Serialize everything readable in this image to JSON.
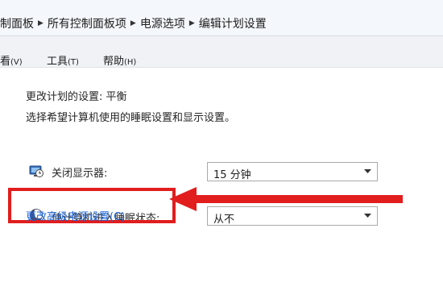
{
  "breadcrumb": {
    "items": [
      "制面板",
      "所有控制面板项",
      "电源选项",
      "编辑计划设置"
    ]
  },
  "menubar": {
    "items": [
      {
        "label": "看",
        "accel": "(V)"
      },
      {
        "label": "工具",
        "accel": "(T)"
      },
      {
        "label": "帮助",
        "accel": "(H)"
      }
    ]
  },
  "plan": {
    "heading": "更改计划的设置: 平衡",
    "instructions": "选择希望计算机使用的睡眠设置和显示设置。"
  },
  "settings": {
    "display_off": {
      "label": "关闭显示器:",
      "value": "15 分钟",
      "icon": "monitor-clock-icon"
    },
    "sleep": {
      "label": "使计算机进入睡眠状态:",
      "value": "从不",
      "icon": "moon-icon"
    }
  },
  "advanced_link": "更改高级电源设置(C)",
  "colors": {
    "link": "#1a64d8",
    "highlight": "#e11d1d"
  }
}
